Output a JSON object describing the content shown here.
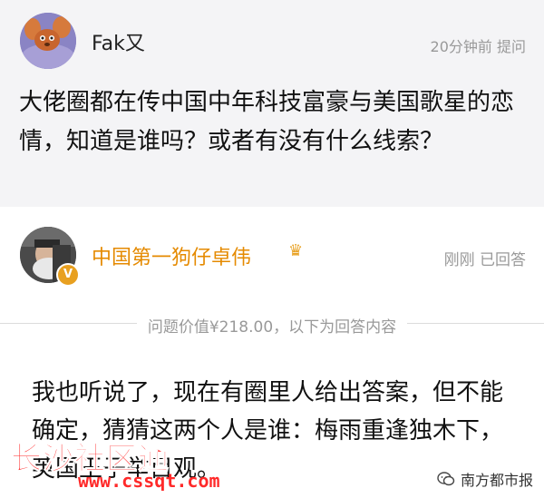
{
  "question": {
    "author": "Fak又",
    "meta": "20分钟前 提问",
    "text": "大佬圈都在传中国中年科技富豪与美国歌星的恋情，知道是谁吗？或者有没有什么线索？"
  },
  "answer": {
    "author": "中国第一狗仔卓伟",
    "meta": "刚刚 已回答",
    "badge": "V",
    "divider": "问题价值¥218.00，以下为回答内容",
    "text": "我也听说了，现在有圈里人给出答案，但不能确定，猜猜这两个人是谁：梅雨重逢独木下，英国王子举目观。"
  },
  "watermark": {
    "text": "长沙社区通",
    "url": "www.cssqt.com"
  },
  "source": {
    "label": "南方都市报",
    "icon": "wechat-icon"
  },
  "colors": {
    "question_bg": "#f4f4f6",
    "author_accent": "#e58a00",
    "watermark": "#ff2a2a"
  }
}
